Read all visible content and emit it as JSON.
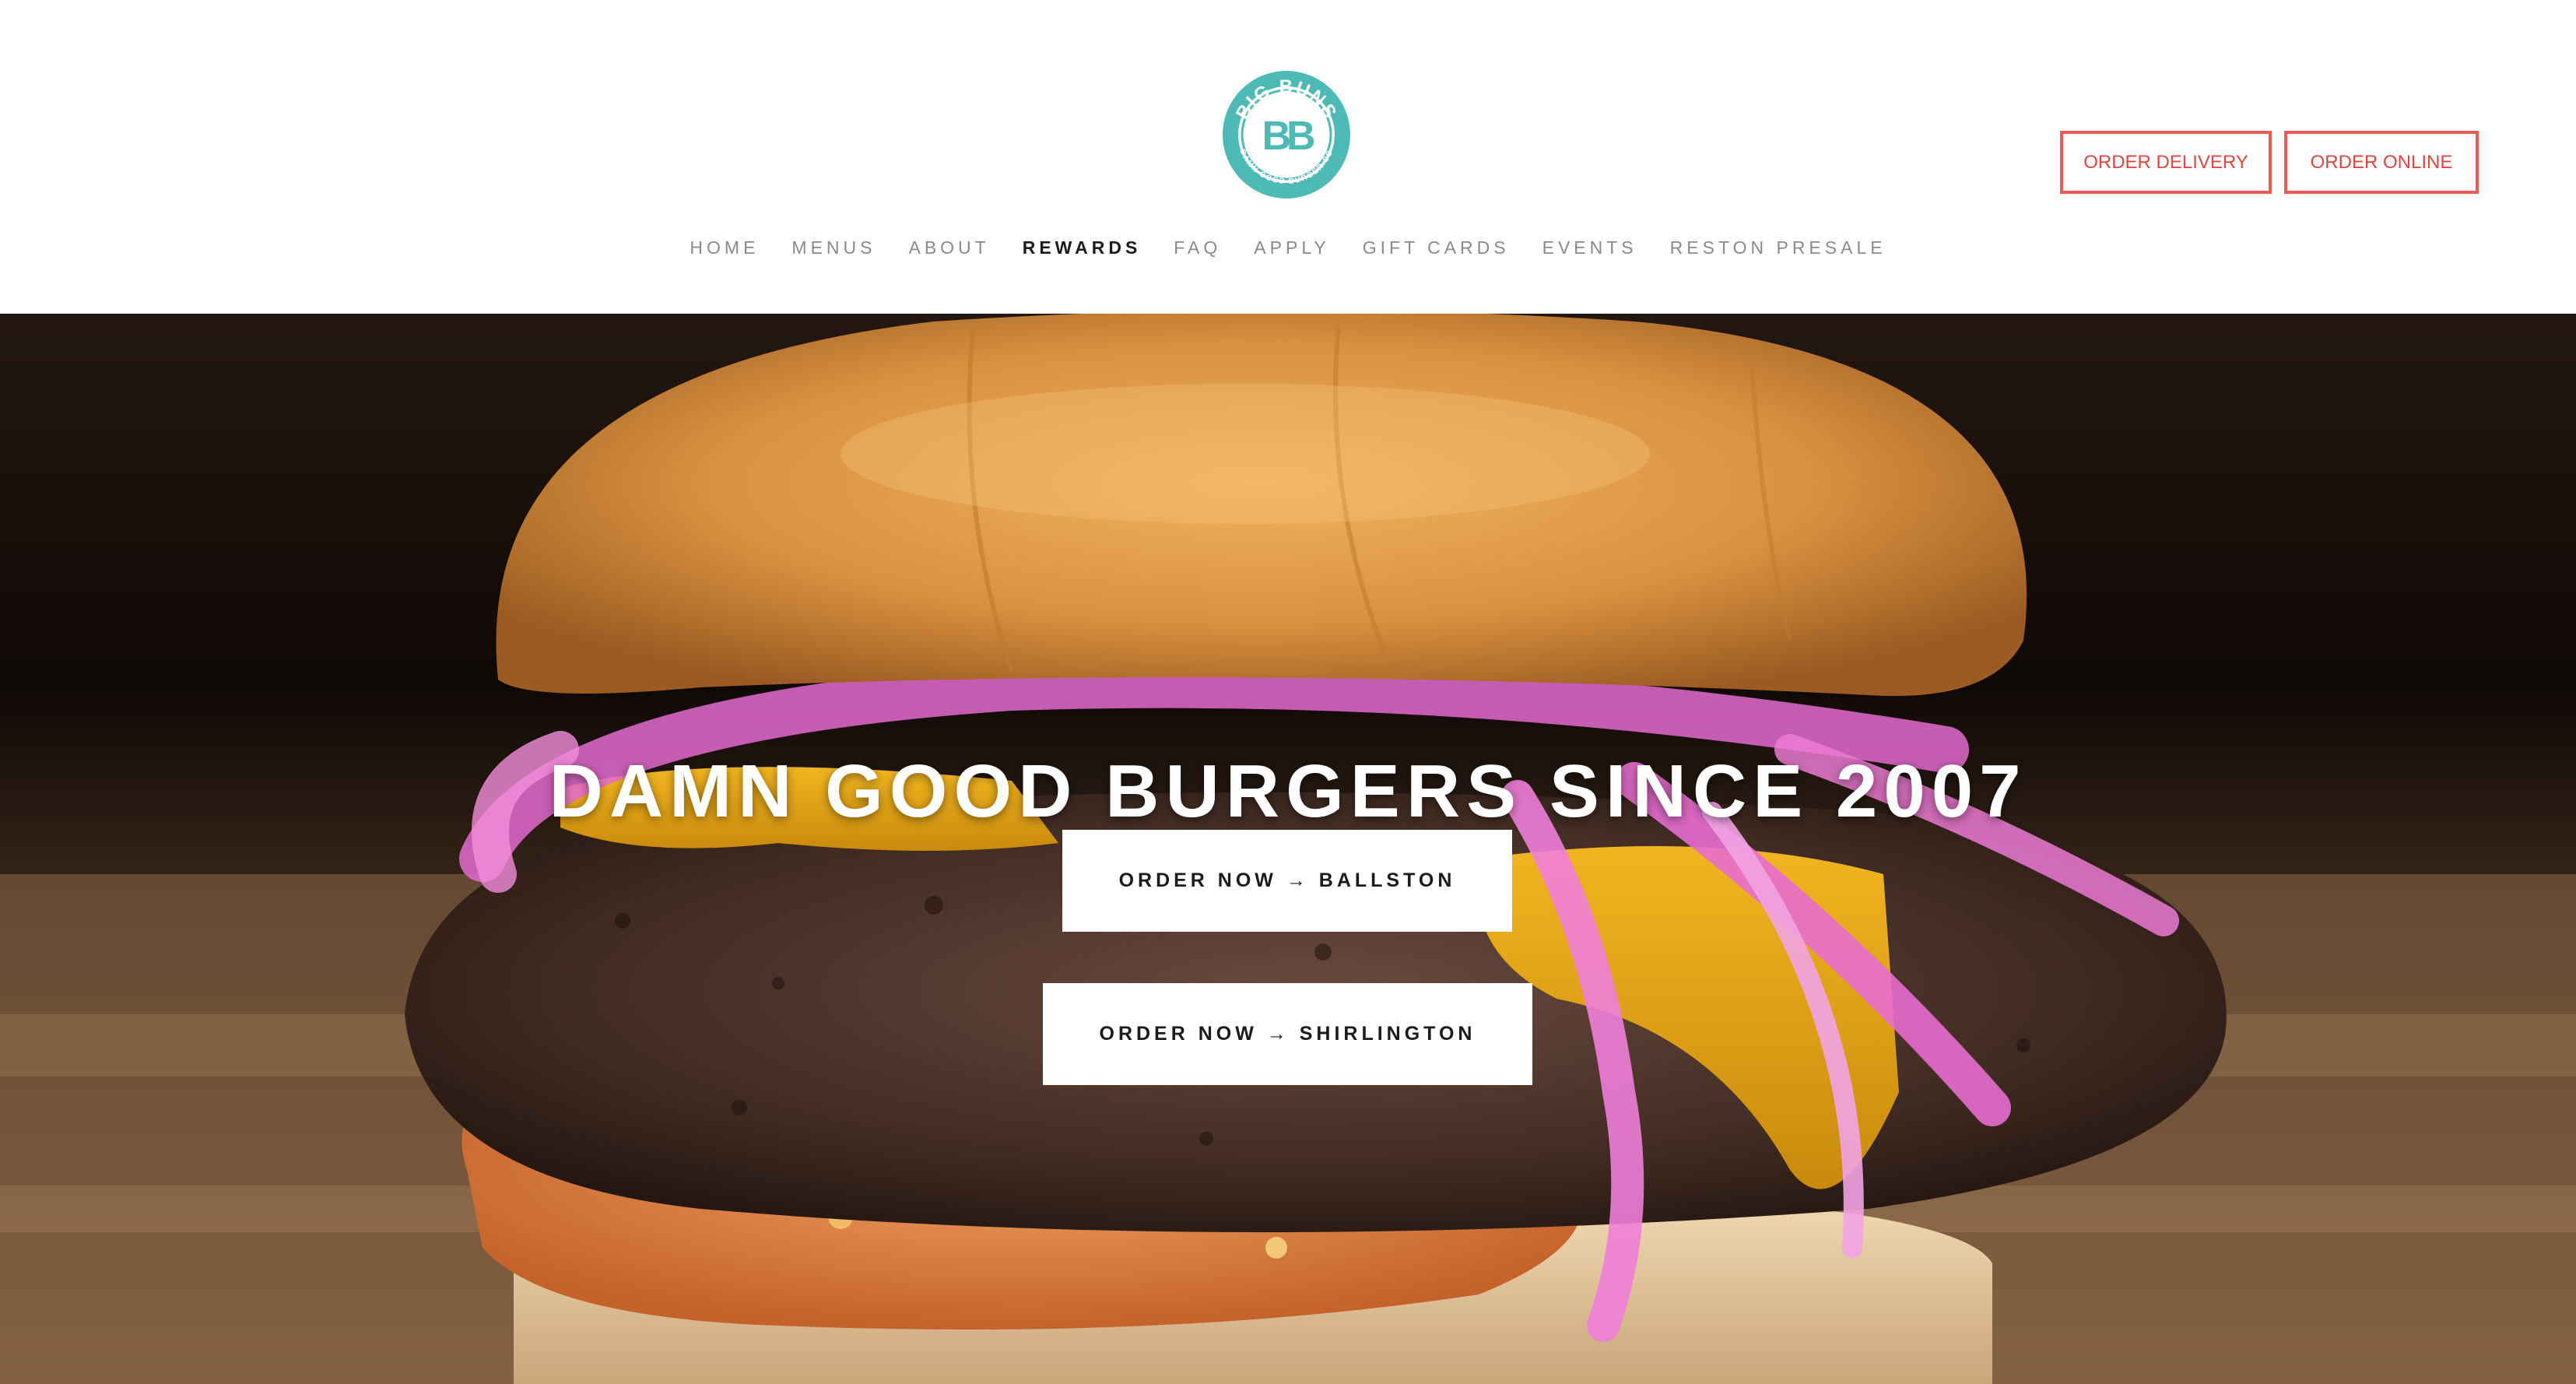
{
  "brand": {
    "name": "BIG BUNS",
    "tagline": "DAMN GOOD BURGER CO",
    "monogram": "BB",
    "accent_color": "#4dbab5",
    "cta_border_color": "#ee5a58"
  },
  "nav": {
    "items": [
      {
        "label": "HOME"
      },
      {
        "label": "MENUS"
      },
      {
        "label": "ABOUT"
      },
      {
        "label": "REWARDS",
        "active": true
      },
      {
        "label": "FAQ"
      },
      {
        "label": "APPLY"
      },
      {
        "label": "GIFT CARDS"
      },
      {
        "label": "EVENTS"
      },
      {
        "label": "RESTON PRESALE"
      }
    ]
  },
  "header_buttons": {
    "delivery": "ORDER DELIVERY",
    "online": "ORDER ONLINE"
  },
  "hero": {
    "title": "DAMN GOOD BURGERS SINCE 2007",
    "ctas": [
      {
        "label": "ORDER NOW → BALLSTON"
      },
      {
        "label": "ORDER NOW → SHIRLINGTON"
      }
    ]
  }
}
